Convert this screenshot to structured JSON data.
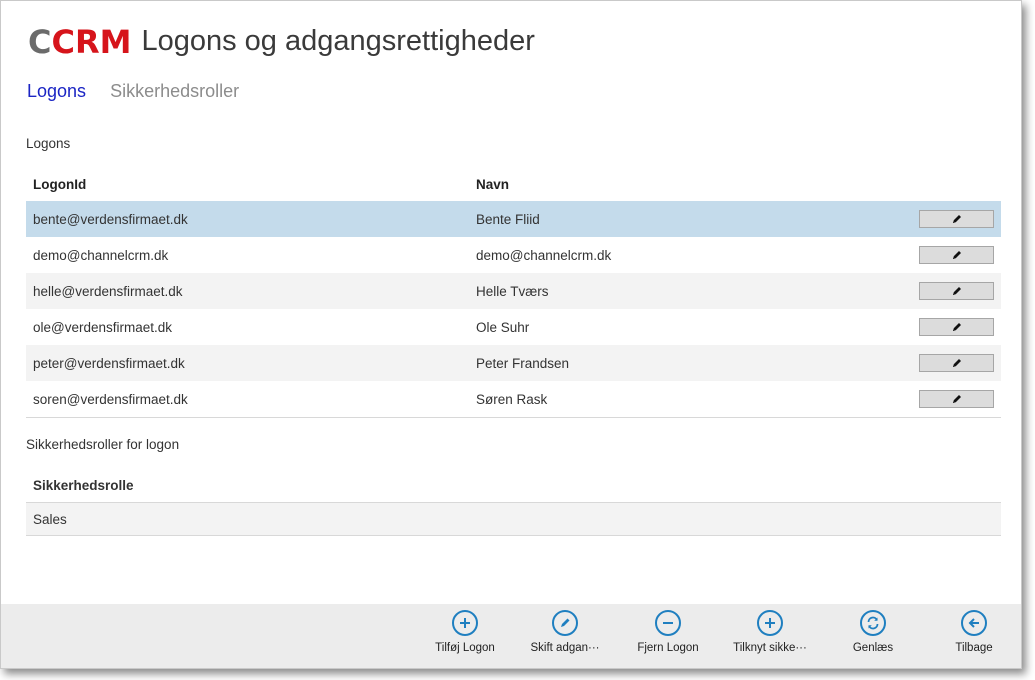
{
  "header": {
    "logo_c": "C",
    "logo_crm": "CRM",
    "title": "Logons og adgangsrettigheder"
  },
  "nav": {
    "tabs": [
      {
        "label": "Logons",
        "active": true
      },
      {
        "label": "Sikkerhedsroller",
        "active": false
      }
    ]
  },
  "logons": {
    "section_label": "Logons",
    "columns": [
      "LogonId",
      "Navn"
    ],
    "rows": [
      {
        "logonid": "bente@verdensfirmaet.dk",
        "navn": "Bente Fliid",
        "selected": true
      },
      {
        "logonid": "demo@channelcrm.dk",
        "navn": "demo@channelcrm.dk"
      },
      {
        "logonid": "helle@verdensfirmaet.dk",
        "navn": "Helle Tværs"
      },
      {
        "logonid": "ole@verdensfirmaet.dk",
        "navn": "Ole Suhr"
      },
      {
        "logonid": "peter@verdensfirmaet.dk",
        "navn": "Peter Frandsen"
      },
      {
        "logonid": "soren@verdensfirmaet.dk",
        "navn": "Søren Rask"
      }
    ],
    "row_action_icon": "pencil-icon"
  },
  "roles": {
    "section_label": "Sikkerhedsroller for logon",
    "column": "Sikkerhedsrolle",
    "rows": [
      "Sales"
    ]
  },
  "appbar": {
    "buttons": [
      {
        "label": "Tilføj Logon",
        "icon": "plus-icon"
      },
      {
        "label": "Skift adgan···",
        "icon": "pencil-icon"
      },
      {
        "label": "Fjern Logon",
        "icon": "minus-icon"
      },
      {
        "label": "Tilknyt sikke···",
        "icon": "plus-icon"
      },
      {
        "label": "Genlæs",
        "icon": "refresh-icon"
      },
      {
        "label": "Tilbage",
        "icon": "back-arrow-icon"
      }
    ]
  },
  "colors": {
    "accent_blue": "#1f7fc0",
    "nav_active": "#1b25c4",
    "selected_row": "#c4dbeb",
    "logo_red": "#d6141b",
    "logo_gray": "#6b6b6b"
  }
}
